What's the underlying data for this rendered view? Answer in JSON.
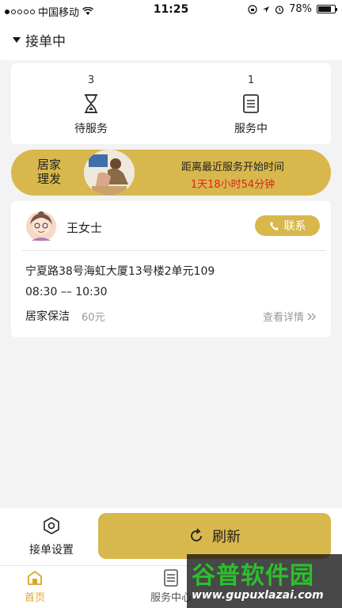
{
  "status_bar": {
    "carrier": "中国移动",
    "time": "11:25",
    "battery": "78%",
    "battery_level": 0.78
  },
  "header": {
    "toggle_label": "接单中"
  },
  "counts": [
    {
      "count": "3",
      "label": "待服务",
      "icon": "hourglass-icon"
    },
    {
      "count": "1",
      "label": "服务中",
      "icon": "document-icon"
    }
  ],
  "banner": {
    "title": "居家理发",
    "line1": "距离最近服务开始时间",
    "countdown": "1天18小时54分钟"
  },
  "order": {
    "customer_name": "王女士",
    "contact_label": "联系",
    "address": "宁夏路38号海虹大厦13号楼2单元109",
    "time_range": "08:30 –– 10:30",
    "service_type": "居家保洁",
    "price": "60元",
    "detail_label": "查看详情"
  },
  "actions": {
    "settings_label": "接单设置",
    "refresh_label": "刷新"
  },
  "tabs": [
    {
      "label": "首页",
      "active": true
    },
    {
      "label": "服务中心",
      "active": false
    }
  ],
  "watermark": {
    "title": "谷普软件园",
    "url": "www.gupuxlazai.com"
  },
  "colors": {
    "accent": "#d8b84c",
    "countdown": "#e02020",
    "active_tab": "#d8a829"
  }
}
